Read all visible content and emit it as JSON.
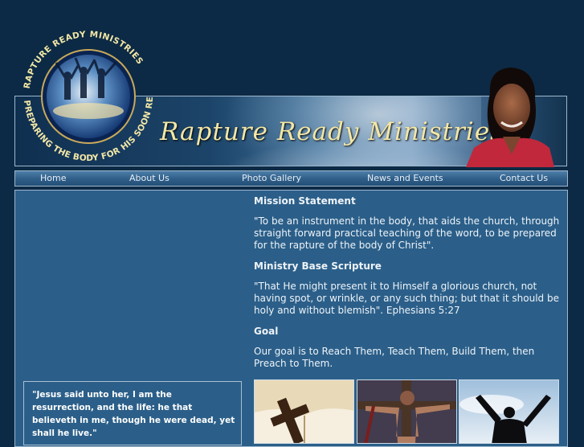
{
  "site": {
    "title": "Rapture Ready Ministries",
    "logo_top_text": "RAPTURE READY MINISTRIES",
    "logo_bottom_text": "PREPARING THE BODY FOR HIS SOON RETURN"
  },
  "nav": {
    "items": [
      {
        "label": "Home"
      },
      {
        "label": "About Us"
      },
      {
        "label": "Photo Gallery"
      },
      {
        "label": "News and Events"
      },
      {
        "label": "Contact Us"
      }
    ]
  },
  "main": {
    "mission_heading": "Mission Statement",
    "mission_text": "\"To be an instrument in the body, that aids the church, through straight forward practical teaching of the word, to be prepared for the rapture of the body of Christ\".",
    "scripture_heading": "Ministry Base Scripture",
    "scripture_text": "\"That He might present it to Himself a glorious church, not having spot, or wrinkle, or any such thing; but that it should be holy and without blemish\". Ephesians 5:27",
    "goal_heading": "Goal",
    "goal_text": "Our goal is to Reach Them, Teach Them, Build Them, then Preach to Them."
  },
  "sidebar": {
    "quote": "\"Jesus said unto her, I am the resurrection, and the life: he that believeth in me, though he were dead, yet shall he live.\""
  },
  "colors": {
    "page_bg": "#0c2a45",
    "panel_bg": "#2b5f89",
    "title_gold": "#f3e7a6"
  }
}
